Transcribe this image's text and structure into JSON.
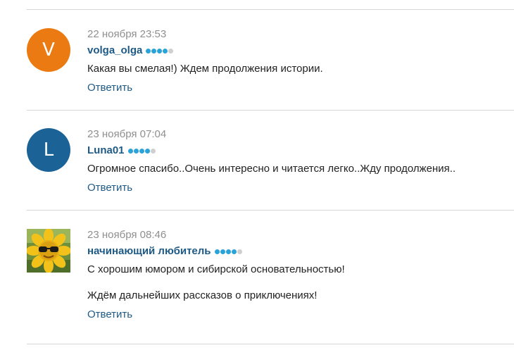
{
  "reply_label": "Ответить",
  "colors": {
    "link": "#1e5a86",
    "rating_on": "#29a3d8",
    "rating_off": "#cfcfcf"
  },
  "comments": [
    {
      "avatar_letter": "V",
      "avatar_color": "#ec7a13",
      "date": "22 ноября 23:53",
      "author": "volga_olga",
      "rating": 4,
      "rating_max": 5,
      "text": [
        "Какая вы смелая!) Ждем продолжения истории."
      ]
    },
    {
      "avatar_letter": "L",
      "avatar_color": "#1b6297",
      "date": "23 ноября 07:04",
      "author": "Luna01",
      "rating": 4,
      "rating_max": 5,
      "text": [
        "Огромное спасибо..Очень интересно и читается легко..Жду продолжения.."
      ]
    },
    {
      "avatar_icon": "sunflower-with-sunglasses-photo",
      "date": "23 ноября 08:46",
      "author": "начинающий любитель",
      "rating": 4,
      "rating_max": 5,
      "text": [
        "С хорошим юмором и сибирской основательностью!",
        "Ждём дальнейших рассказов о приключениях!"
      ]
    }
  ]
}
